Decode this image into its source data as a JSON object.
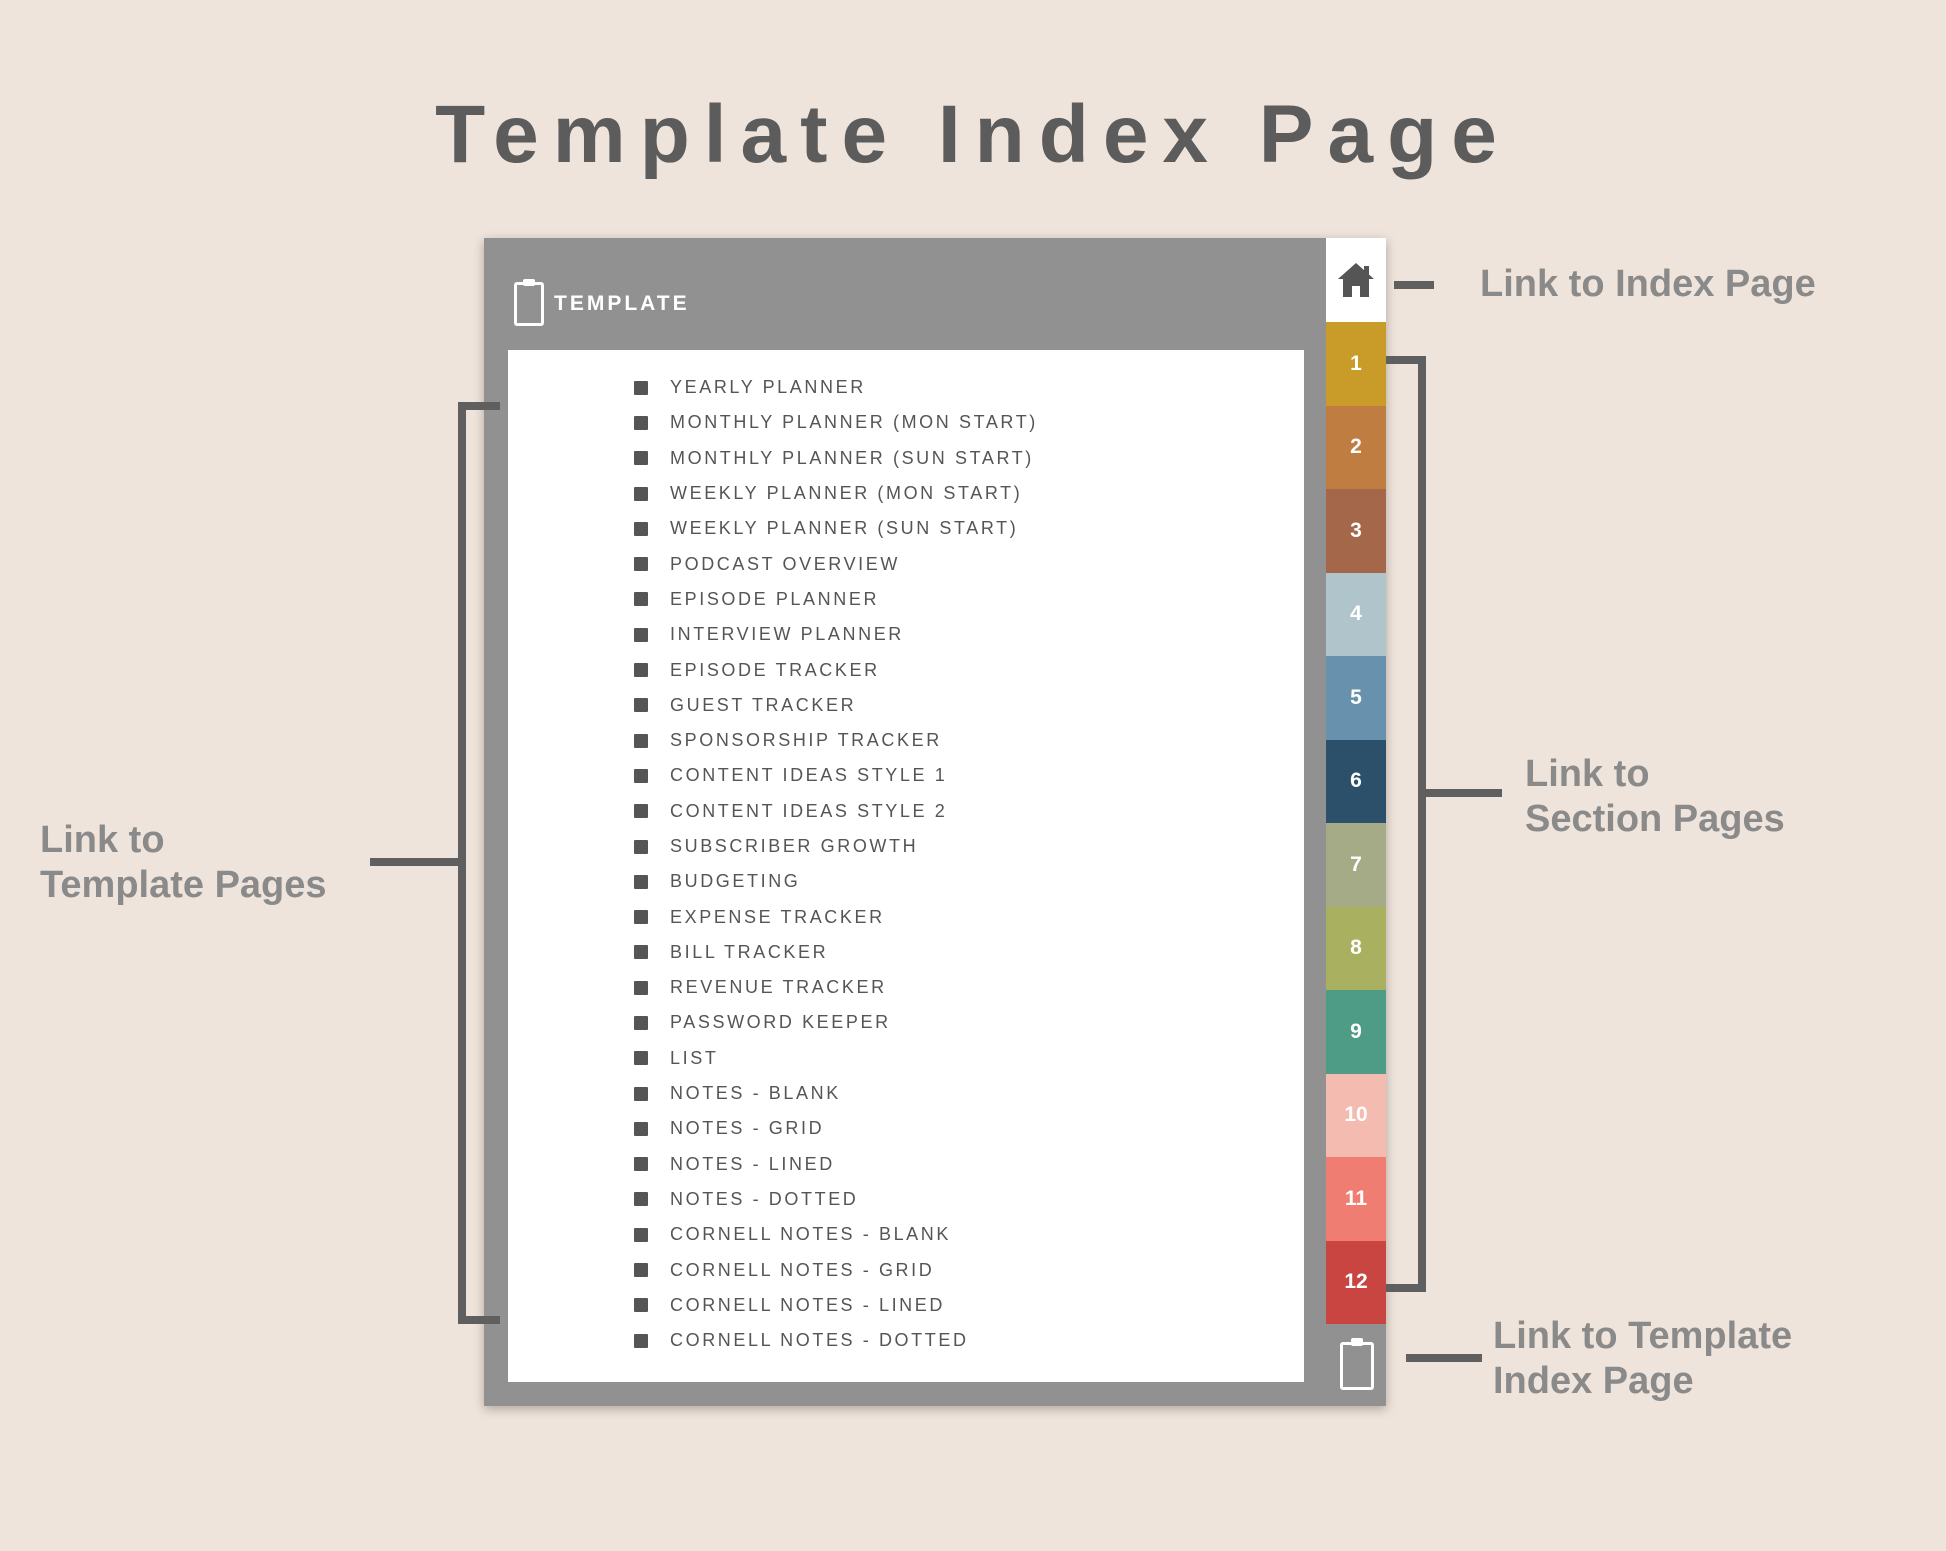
{
  "title": "Template Index Page",
  "device": {
    "header_title": "TEMPLATE",
    "template_items": [
      "YEARLY PLANNER",
      "MONTHLY PLANNER (MON START)",
      "MONTHLY PLANNER (SUN START)",
      "WEEKLY PLANNER (MON START)",
      "WEEKLY PLANNER (SUN START)",
      "PODCAST OVERVIEW",
      "EPISODE PLANNER",
      "INTERVIEW PLANNER",
      "EPISODE TRACKER",
      "GUEST TRACKER",
      "SPONSORSHIP TRACKER",
      "CONTENT IDEAS STYLE 1",
      "CONTENT IDEAS STYLE 2",
      "SUBSCRIBER GROWTH",
      "BUDGETING",
      "EXPENSE TRACKER",
      "BILL TRACKER",
      "REVENUE TRACKER",
      "PASSWORD KEEPER",
      "LIST",
      "NOTES - BLANK",
      "NOTES - GRID",
      "NOTES - LINED",
      "NOTES - DOTTED",
      "CORNELL NOTES - BLANK",
      "CORNELL NOTES - GRID",
      "CORNELL NOTES - LINED",
      "CORNELL NOTES - DOTTED"
    ],
    "home_tab_icon": "home-icon",
    "bottom_tab_icon": "clipboard-icon",
    "section_tabs": [
      {
        "label": "1",
        "color": "#c99c2a"
      },
      {
        "label": "2",
        "color": "#c07d42"
      },
      {
        "label": "3",
        "color": "#a5674a"
      },
      {
        "label": "4",
        "color": "#b0c4cb"
      },
      {
        "label": "5",
        "color": "#6891ad"
      },
      {
        "label": "6",
        "color": "#2c5069"
      },
      {
        "label": "7",
        "color": "#a5aa87"
      },
      {
        "label": "8",
        "color": "#a9b060"
      },
      {
        "label": "9",
        "color": "#4e9b86"
      },
      {
        "label": "10",
        "color": "#f4bcb0"
      },
      {
        "label": "11",
        "color": "#ef7d72"
      },
      {
        "label": "12",
        "color": "#c94541"
      }
    ]
  },
  "annotations": {
    "index_page": "Link to Index Page",
    "section_pages": [
      "Link to",
      "Section Pages"
    ],
    "template_pages": [
      "Link to",
      "Template Pages"
    ],
    "template_index": [
      "Link to Template",
      "Index Page"
    ]
  },
  "colors": {
    "background": "#efe4db",
    "device_frame": "#919191",
    "text_dark": "#5c5c5c",
    "annotation_text": "#8a8a8a"
  }
}
